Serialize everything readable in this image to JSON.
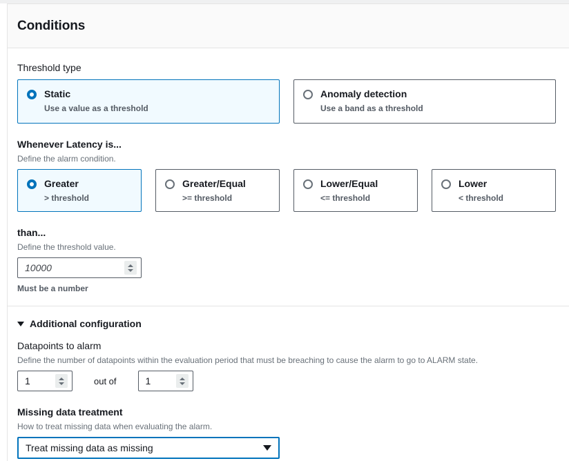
{
  "card": {
    "title": "Conditions"
  },
  "threshold_type": {
    "label": "Threshold type",
    "options": [
      {
        "title": "Static",
        "description": "Use a value as a threshold",
        "selected": true
      },
      {
        "title": "Anomaly detection",
        "description": "Use a band as a threshold",
        "selected": false
      }
    ]
  },
  "condition": {
    "label": "Whenever Latency is...",
    "description": "Define the alarm condition.",
    "options": [
      {
        "title": "Greater",
        "description": "> threshold",
        "selected": true
      },
      {
        "title": "Greater/Equal",
        "description": ">= threshold",
        "selected": false
      },
      {
        "title": "Lower/Equal",
        "description": "<= threshold",
        "selected": false
      },
      {
        "title": "Lower",
        "description": "< threshold",
        "selected": false
      }
    ]
  },
  "threshold_value": {
    "label": "than...",
    "description": "Define the threshold value.",
    "value": "",
    "placeholder": "10000",
    "display": "10000",
    "hint": "Must be a number"
  },
  "additional_configuration": {
    "label": "Additional configuration",
    "expanded": true,
    "caret_icon": "caret-down-icon"
  },
  "datapoints_to_alarm": {
    "label": "Datapoints to alarm",
    "description": "Define the number of datapoints within the evaluation period that must be breaching to cause the alarm to go to ALARM state.",
    "datapoints_value": "1",
    "separator": "out of",
    "evaluation_value": "1"
  },
  "missing_data": {
    "label": "Missing data treatment",
    "description": "How to treat missing data when evaluating the alarm.",
    "selected": "Treat missing data as missing",
    "caret_icon": "caret-down-icon"
  },
  "colors": {
    "accent": "#0073bb",
    "selected_tile_bg": "#f1faff",
    "border": "#545b64",
    "text": "#16191f",
    "muted": "#687078",
    "header_bg": "#fafafa",
    "divider": "#e4e4e4"
  }
}
